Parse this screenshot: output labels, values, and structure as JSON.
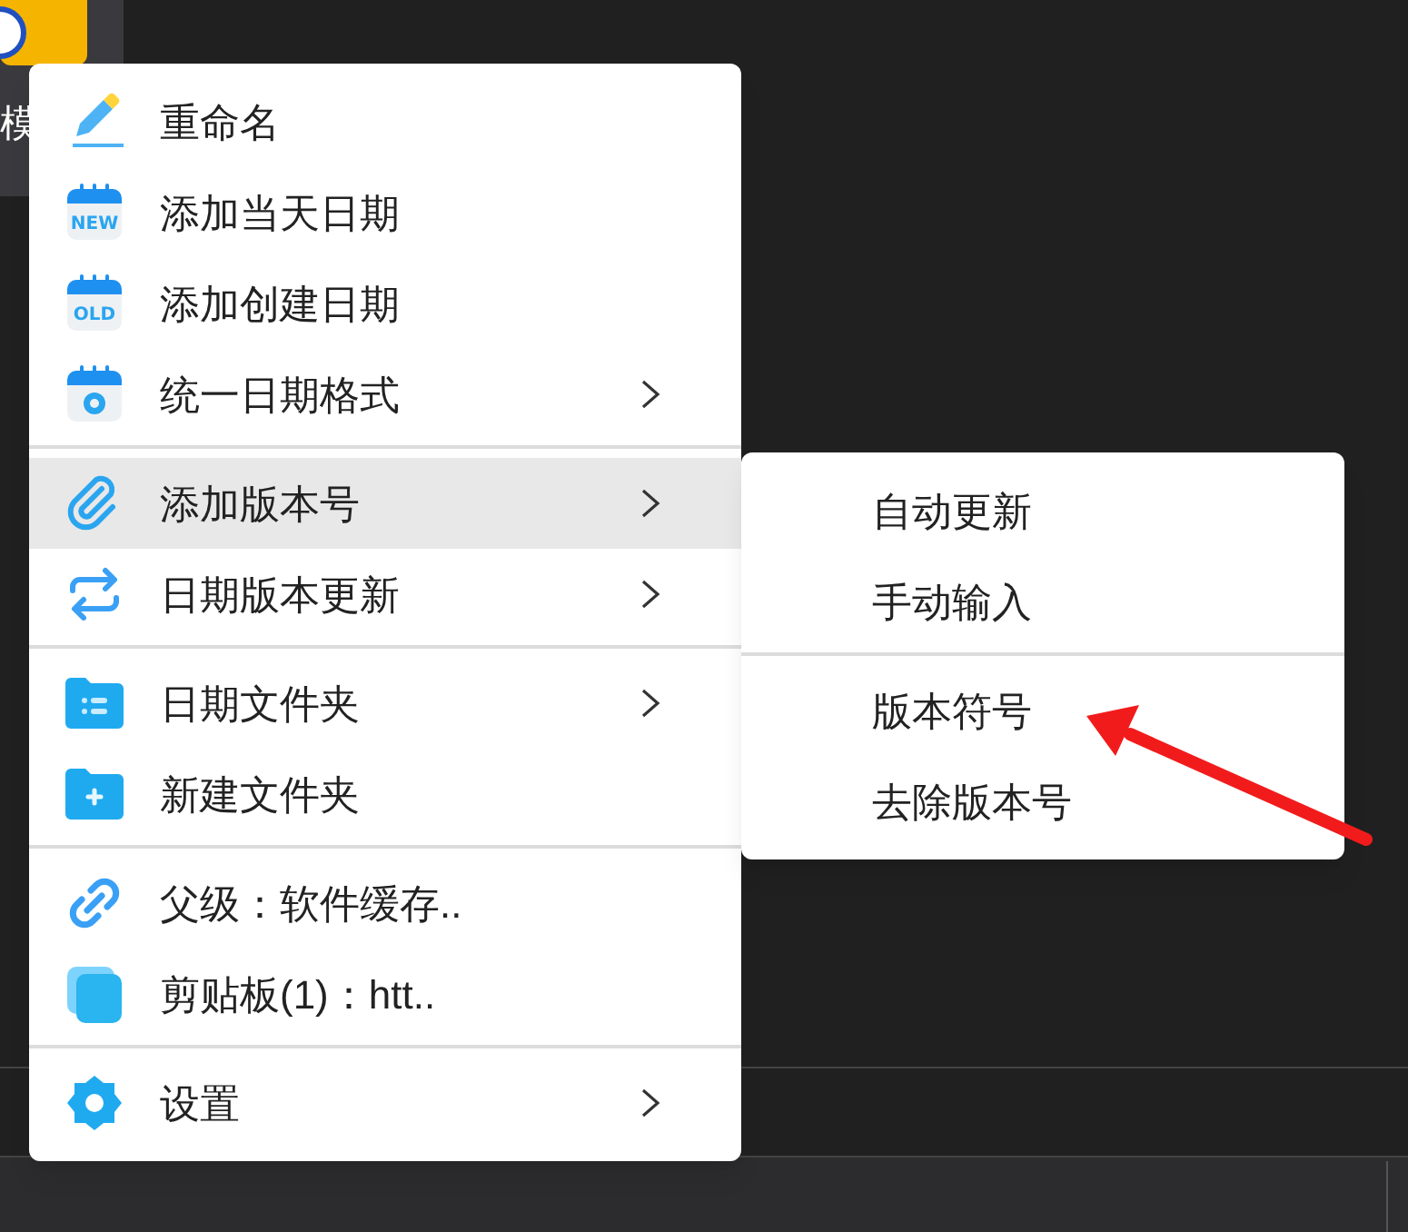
{
  "desktop_icon": {
    "label": "模"
  },
  "menu": {
    "groups": [
      {
        "items": [
          {
            "label": "重命名",
            "has_submenu": false,
            "selected": false
          },
          {
            "label": "添加当天日期",
            "icon_text": "NEW",
            "has_submenu": false,
            "selected": false
          },
          {
            "label": "添加创建日期",
            "icon_text": "OLD",
            "has_submenu": false,
            "selected": false
          },
          {
            "label": "统一日期格式",
            "has_submenu": true,
            "selected": false
          }
        ]
      },
      {
        "items": [
          {
            "label": "添加版本号",
            "has_submenu": true,
            "selected": true
          },
          {
            "label": "日期版本更新",
            "has_submenu": true,
            "selected": false
          }
        ]
      },
      {
        "items": [
          {
            "label": "日期文件夹",
            "has_submenu": true,
            "selected": false
          },
          {
            "label": "新建文件夹",
            "has_submenu": false,
            "selected": false
          }
        ]
      },
      {
        "items": [
          {
            "label": "父级：软件缓存..",
            "has_submenu": false,
            "selected": false
          },
          {
            "label": "剪贴板(1)：htt..",
            "has_submenu": false,
            "selected": false
          }
        ]
      },
      {
        "items": [
          {
            "label": "设置",
            "has_submenu": true,
            "selected": false
          }
        ]
      }
    ]
  },
  "submenu": {
    "groups": [
      {
        "items": [
          {
            "label": "自动更新",
            "selected": false
          },
          {
            "label": "手动输入",
            "selected": false
          }
        ]
      },
      {
        "items": [
          {
            "label": "版本符号",
            "selected": false
          },
          {
            "label": "去除版本号",
            "selected": false
          }
        ]
      }
    ]
  }
}
